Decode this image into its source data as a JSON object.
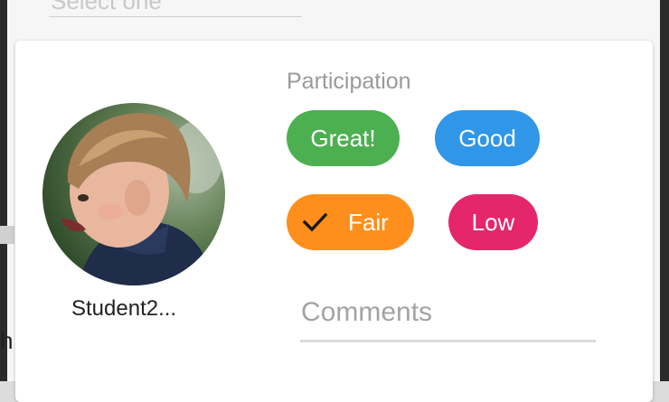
{
  "background_field": {
    "value": "Select one"
  },
  "card": {
    "student": {
      "name": "Student2..."
    },
    "participation": {
      "label": "Participation",
      "options": [
        {
          "label": "Great!",
          "color": "#4caf50",
          "selected": false
        },
        {
          "label": "Good",
          "color": "#2f96e8",
          "selected": false
        },
        {
          "label": "Fair",
          "color": "#ff8f1c",
          "selected": true
        },
        {
          "label": "Low",
          "color": "#e5266b",
          "selected": false
        }
      ]
    },
    "comments": {
      "placeholder": "Comments"
    }
  },
  "icons": {
    "selected_indicator": "checkmark-icon"
  },
  "stray_text": "h"
}
